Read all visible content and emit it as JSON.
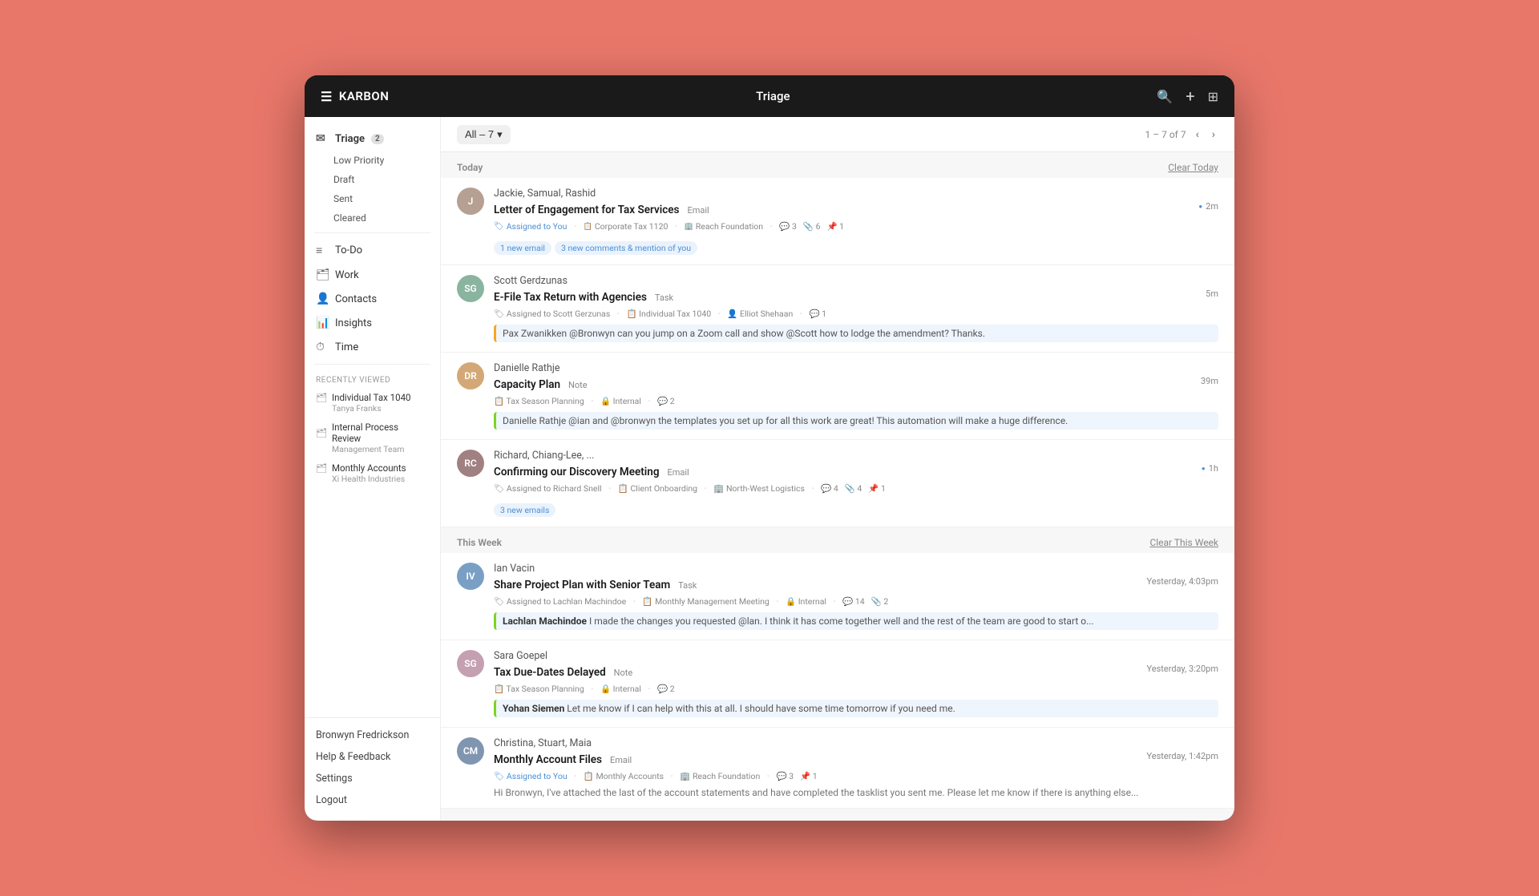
{
  "topbar": {
    "brand": "KARBON",
    "title": "Triage",
    "search_icon": "🔍",
    "add_icon": "+",
    "grid_icon": "⊞"
  },
  "sidebar": {
    "triage_label": "Triage",
    "triage_count": "2",
    "sub_items": [
      {
        "label": "Low Priority"
      },
      {
        "label": "Draft"
      },
      {
        "label": "Sent"
      },
      {
        "label": "Cleared"
      }
    ],
    "nav_items": [
      {
        "icon": "≡",
        "label": "To-Do"
      },
      {
        "icon": "🗂",
        "label": "Work"
      },
      {
        "icon": "👤",
        "label": "Contacts"
      },
      {
        "icon": "📊",
        "label": "Insights"
      },
      {
        "icon": "⏱",
        "label": "Time"
      }
    ],
    "recently_viewed_label": "RECENTLY VIEWED",
    "recent_items": [
      {
        "icon": "🗂",
        "name": "Individual Tax 1040",
        "sub": "Tanya Franks"
      },
      {
        "icon": "🗂",
        "name": "Internal Process Review",
        "sub": "Management Team"
      },
      {
        "icon": "🗂",
        "name": "Monthly Accounts",
        "sub": "Xi Health Industries"
      }
    ],
    "bottom_items": [
      {
        "label": "Bronwyn Fredrickson"
      },
      {
        "label": "Help & Feedback"
      },
      {
        "label": "Settings"
      },
      {
        "label": "Logout"
      }
    ]
  },
  "content": {
    "filter_label": "All – 7",
    "pagination": "1 – 7 of 7",
    "sections": [
      {
        "label": "Today",
        "clear_label": "Clear Today",
        "items": [
          {
            "avatar_initials": "J",
            "avatar_color": "#b5a093",
            "sender": "Jackie, Samual, Rashid",
            "subject": "Letter of Engagement for Tax Services",
            "type": "Email",
            "time": "2m",
            "time_dot": true,
            "meta": [
              {
                "icon": "🏷",
                "text": "Assigned to You",
                "blue": true
              },
              {
                "icon": "📋",
                "text": "Corporate Tax 1120"
              },
              {
                "icon": "🏢",
                "text": "Reach Foundation"
              },
              {
                "icon": "💬",
                "text": "3"
              },
              {
                "icon": "📎",
                "text": "6"
              },
              {
                "icon": "📌",
                "text": "1"
              }
            ],
            "pills": [
              {
                "text": "1 new email",
                "style": "blue"
              },
              {
                "text": "3 new comments & mention of you",
                "style": "blue"
              }
            ],
            "preview": "",
            "border": "none"
          },
          {
            "avatar_initials": "SG",
            "avatar_color": "#8ab4a0",
            "sender": "Scott Gerdzunas",
            "subject": "E-File Tax Return with Agencies",
            "type": "Task",
            "time": "5m",
            "time_dot": false,
            "meta": [
              {
                "icon": "🏷",
                "text": "Assigned to Scott Gerzunas"
              },
              {
                "icon": "📋",
                "text": "Individual Tax 1040"
              },
              {
                "icon": "👤",
                "text": "Elliot Shehaan"
              },
              {
                "icon": "💬",
                "text": "1"
              }
            ],
            "pills": [],
            "preview": "Pax Zwanikken @Bronwyn can you jump on a Zoom call and show @Scott how to lodge the amendment? Thanks.",
            "border": "orange"
          },
          {
            "avatar_initials": "DR",
            "avatar_color": "#d4a876",
            "sender": "Danielle Rathje",
            "subject": "Capacity Plan",
            "type": "Note",
            "time": "39m",
            "time_dot": false,
            "meta": [
              {
                "icon": "📋",
                "text": "Tax Season Planning"
              },
              {
                "icon": "🔒",
                "text": "Internal"
              },
              {
                "icon": "💬",
                "text": "2"
              }
            ],
            "pills": [],
            "preview": "Danielle Rathje @ian and @bronwyn the templates you set up for all this work are great! This automation will make a huge difference.",
            "border": "green"
          },
          {
            "avatar_initials": "RC",
            "avatar_color": "#a08080",
            "sender": "Richard, Chiang-Lee, ...",
            "subject": "Confirming our Discovery Meeting",
            "type": "Email",
            "time": "1h",
            "time_dot": true,
            "meta": [
              {
                "icon": "🏷",
                "text": "Assigned to Richard Snell"
              },
              {
                "icon": "📋",
                "text": "Client Onboarding"
              },
              {
                "icon": "🏢",
                "text": "North-West Logistics"
              },
              {
                "icon": "💬",
                "text": "4"
              },
              {
                "icon": "📎",
                "text": "4"
              },
              {
                "icon": "📌",
                "text": "1"
              }
            ],
            "pills": [
              {
                "text": "3 new emails",
                "style": "blue"
              }
            ],
            "preview": "",
            "border": "none"
          }
        ]
      },
      {
        "label": "This Week",
        "clear_label": "Clear This Week",
        "items": [
          {
            "avatar_initials": "IV",
            "avatar_color": "#7a9fc4",
            "sender": "Ian Vacin",
            "subject": "Share Project Plan with Senior Team",
            "type": "Task",
            "time": "Yesterday, 4:03pm",
            "time_dot": false,
            "meta": [
              {
                "icon": "🏷",
                "text": "Assigned to Lachlan Machindoe"
              },
              {
                "icon": "📋",
                "text": "Monthly Management Meeting"
              },
              {
                "icon": "🔒",
                "text": "Internal"
              },
              {
                "icon": "💬",
                "text": "14"
              },
              {
                "icon": "📎",
                "text": "2"
              }
            ],
            "pills": [],
            "preview": "Lachlan Machindoe I made the changes you requested @lan. I think it has come together well and the rest of the team are good to start o...",
            "preview_bold": "Lachlan Machindoe",
            "border": "green"
          },
          {
            "avatar_initials": "SG2",
            "avatar_color": "#c4a0b0",
            "sender": "Sara Goepel",
            "subject": "Tax Due-Dates Delayed",
            "type": "Note",
            "time": "Yesterday, 3:20pm",
            "time_dot": false,
            "meta": [
              {
                "icon": "📋",
                "text": "Tax Season Planning"
              },
              {
                "icon": "🔒",
                "text": "Internal"
              },
              {
                "icon": "💬",
                "text": "2"
              }
            ],
            "pills": [],
            "preview": "Yohan Siemen Let me know if I can help with this at all. I should have some time tomorrow if you need me.",
            "preview_bold": "Yohan Siemen",
            "border": "green"
          },
          {
            "avatar_initials": "CM",
            "avatar_color": "#8095b0",
            "sender": "Christina, Stuart, Maia",
            "subject": "Monthly Account Files",
            "type": "Email",
            "time": "Yesterday, 1:42pm",
            "time_dot": false,
            "meta": [
              {
                "icon": "🏷",
                "text": "Assigned to You",
                "blue": true
              },
              {
                "icon": "📋",
                "text": "Monthly Accounts"
              },
              {
                "icon": "🏢",
                "text": "Reach Foundation"
              },
              {
                "icon": "💬",
                "text": "3"
              },
              {
                "icon": "📌",
                "text": "1"
              }
            ],
            "pills": [],
            "preview": "Hi Bronwyn, I've attached the last of the account statements and have completed the tasklist you sent me. Please let me know if there is anything else...",
            "border": "none"
          }
        ]
      }
    ]
  }
}
